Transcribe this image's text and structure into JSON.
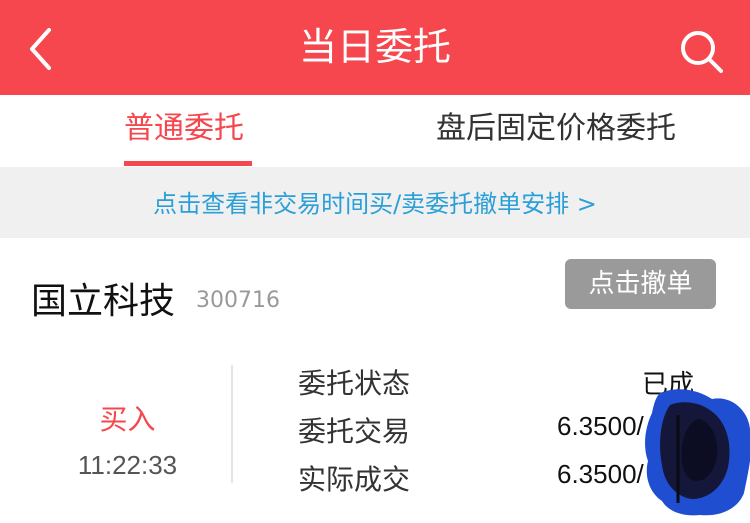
{
  "header": {
    "title": "当日委托",
    "back_icon": "chevron-left-icon",
    "search_icon": "search-icon",
    "bg_color": "#f5474d"
  },
  "tabs": [
    {
      "label": "普通委托",
      "active": true
    },
    {
      "label": "盘后固定价格委托",
      "active": false
    }
  ],
  "notice": {
    "text": "点击查看非交易时间买/卖委托撤单安排 >",
    "color": "#2a9fd8"
  },
  "order": {
    "stock_name": "国立科技",
    "stock_code": "300716",
    "cancel_label": "点击撤单",
    "side": "买入",
    "time": "11:22:33",
    "fields": [
      {
        "label": "委托状态",
        "value": "已成"
      },
      {
        "label": "委托交易",
        "value": "6.3500/"
      },
      {
        "label": "实际成交",
        "value": "6.3500/"
      }
    ]
  }
}
